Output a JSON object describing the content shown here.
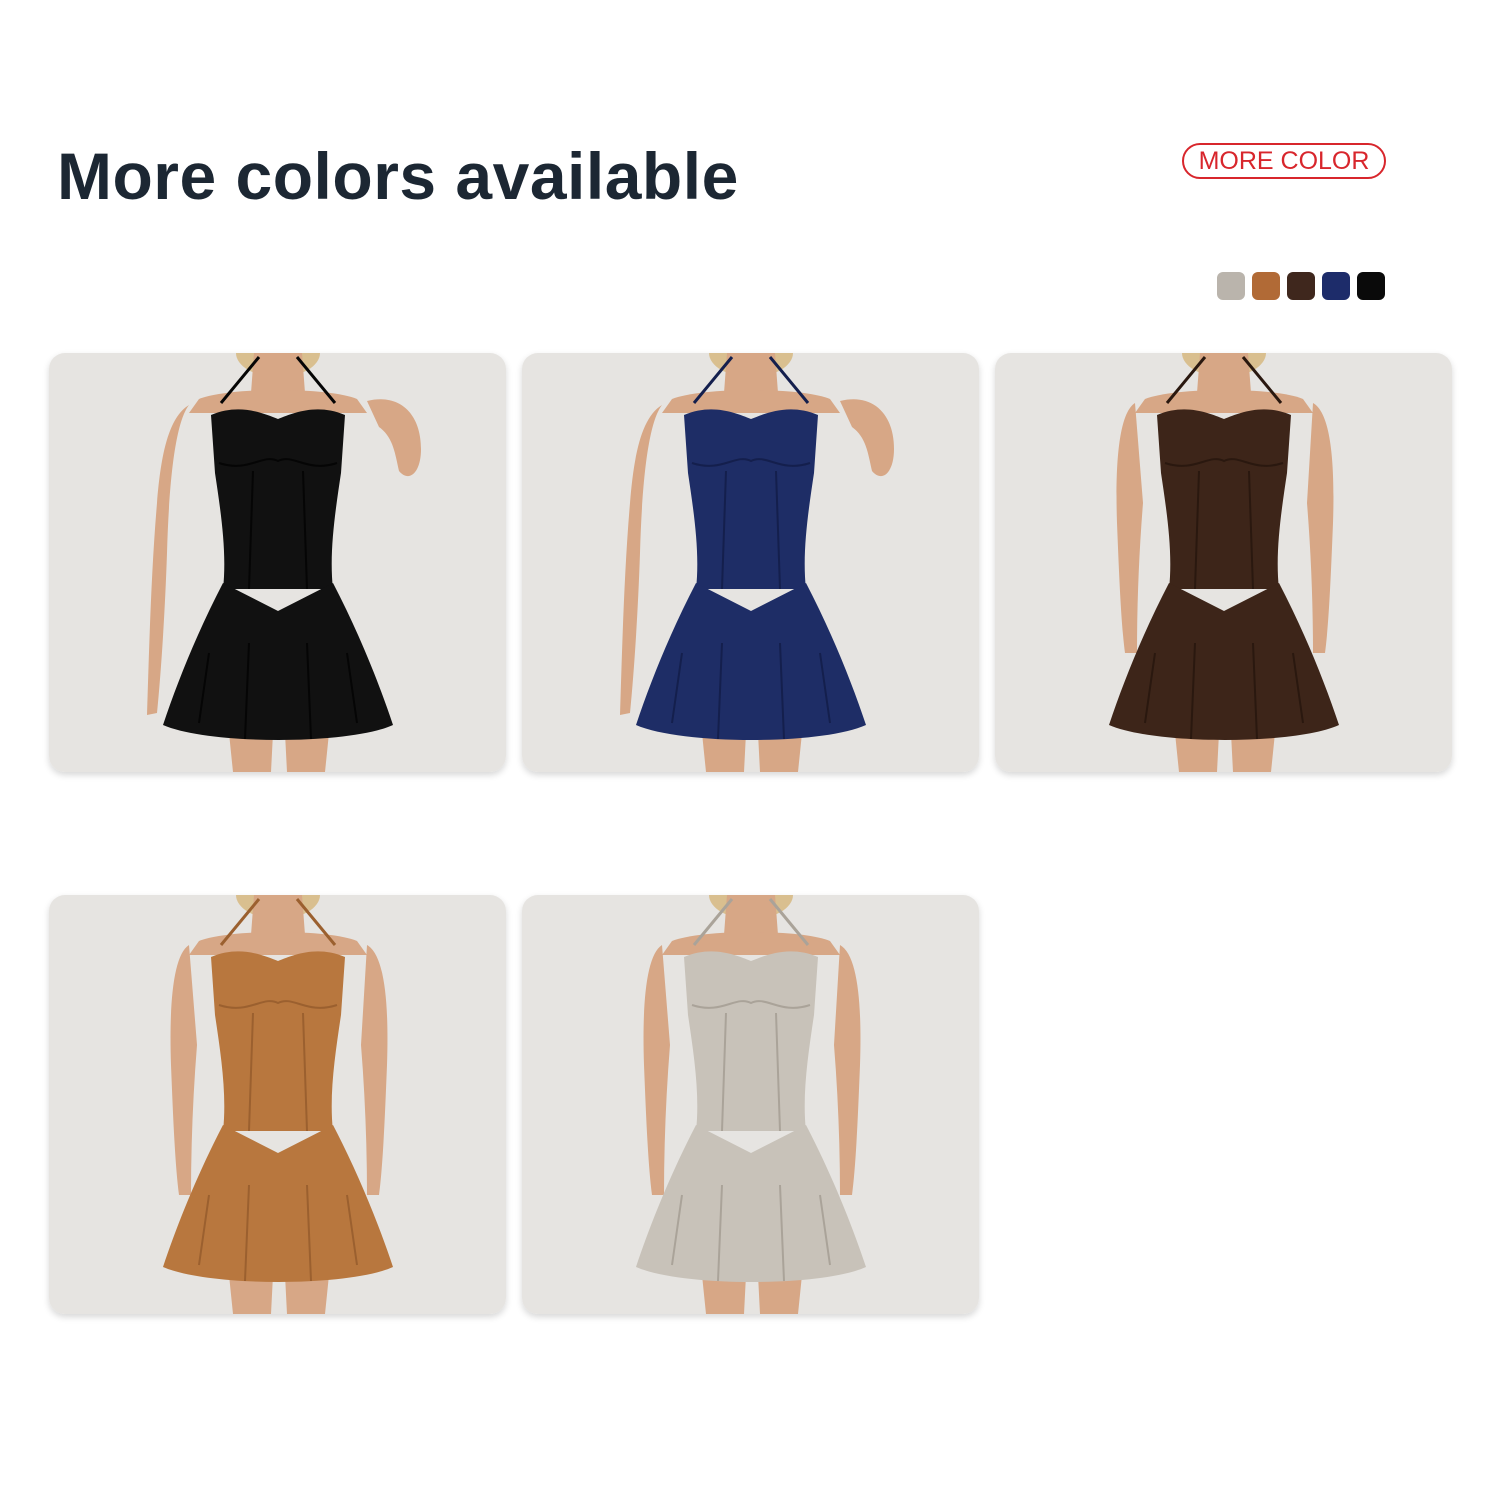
{
  "header": {
    "title": "More colors available",
    "more_color_button": "MORE COLOR"
  },
  "colors": {
    "accent": "#d8262c",
    "title_text": "#1c2733",
    "card_background": "#e6e4e1"
  },
  "swatches": [
    {
      "color": "#bab4ac"
    },
    {
      "color": "#b16a36"
    },
    {
      "color": "#3f271d"
    },
    {
      "color": "#1d2c6a"
    },
    {
      "color": "#0a0a0a"
    }
  ],
  "products": [
    {
      "color": "#111111",
      "accent": "#050505",
      "pose": "lean"
    },
    {
      "color": "#1e2d66",
      "accent": "#141f4d",
      "pose": "lean"
    },
    {
      "color": "#3d2519",
      "accent": "#2a180f",
      "pose": "front"
    },
    {
      "color": "#b8773e",
      "accent": "#9b602f",
      "pose": "front"
    },
    {
      "color": "#c8c2b9",
      "accent": "#aaa399",
      "pose": "front"
    }
  ]
}
